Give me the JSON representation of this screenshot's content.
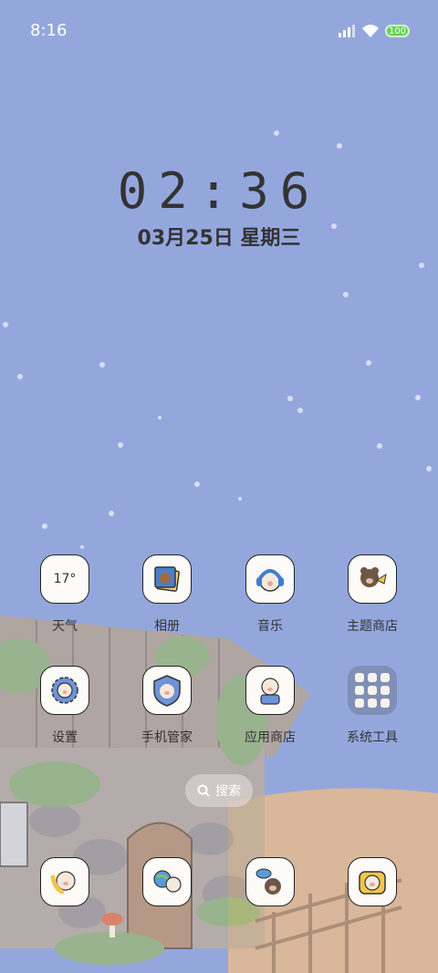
{
  "status_bar": {
    "time": "8:16",
    "battery": "100",
    "wifi_icon": "wifi-icon",
    "signal_icon": "signal-icon"
  },
  "clock": {
    "time": "02:36",
    "date": "03月25日 星期三"
  },
  "apps_row1": [
    {
      "label": "天气",
      "temp": "17°",
      "icon": "weather-icon"
    },
    {
      "label": "相册",
      "icon": "photo-icon"
    },
    {
      "label": "音乐",
      "icon": "music-icon"
    },
    {
      "label": "主题商店",
      "icon": "theme-store-icon"
    }
  ],
  "apps_row2": [
    {
      "label": "设置",
      "icon": "gear-icon"
    },
    {
      "label": "手机管家",
      "icon": "shield-icon"
    },
    {
      "label": "应用商店",
      "icon": "app-store-icon"
    },
    {
      "label": "系统工具",
      "icon": "folder-icon"
    }
  ],
  "search": {
    "label": "搜索"
  },
  "dock": [
    {
      "icon": "phone-icon"
    },
    {
      "icon": "browser-icon"
    },
    {
      "icon": "message-icon"
    },
    {
      "icon": "camera-icon"
    }
  ],
  "colors": {
    "sky": "#94a7dd",
    "ground": "#d9b79a",
    "icon_bg": "#fcfbf7"
  }
}
